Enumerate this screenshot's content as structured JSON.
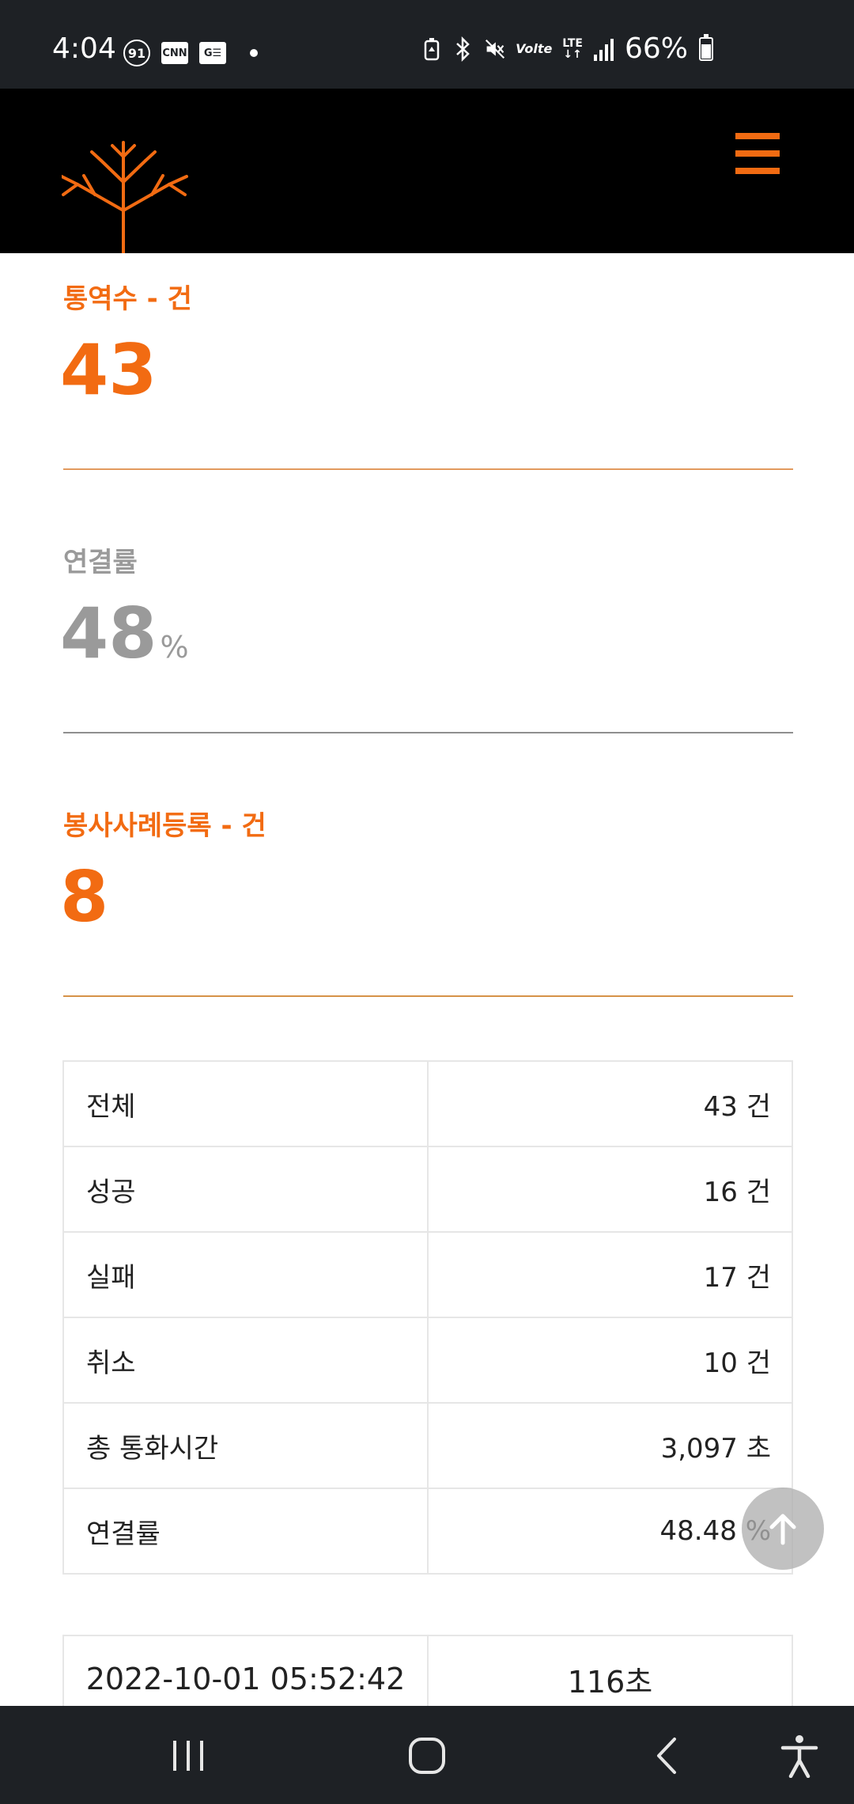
{
  "status_bar": {
    "time": "4:04",
    "aod_badge": "91",
    "cnn_icon": "CNN",
    "ge_icon": "G☰",
    "battery_percent": "66%",
    "volte": "Volte",
    "lte": "LTE",
    "icons": [
      "battery-saver-icon",
      "bluetooth-icon",
      "mute-icon",
      "volte-icon",
      "lte-icon",
      "signal-icon",
      "battery-icon"
    ]
  },
  "header": {
    "logo": "tree-logo-icon",
    "menu": "hamburger-menu-icon"
  },
  "stats": [
    {
      "label": "통역수 - 건",
      "value": "43",
      "unit": ""
    },
    {
      "label": "연결률",
      "value": "48",
      "unit": "%"
    },
    {
      "label": "봉사사례등록 - 건",
      "value": "8",
      "unit": ""
    }
  ],
  "summary": [
    {
      "label": "전체",
      "value": "43 건"
    },
    {
      "label": "성공",
      "value": "16 건"
    },
    {
      "label": "실패",
      "value": "17 건"
    },
    {
      "label": "취소",
      "value": "10 건"
    },
    {
      "label": "총 통화시간",
      "value": "3,097 초"
    },
    {
      "label": "연결률",
      "value": "48.48 %"
    }
  ],
  "records": [
    {
      "datetime": "2022-10-01 05:52:42",
      "duration": "116초"
    }
  ],
  "colors": {
    "accent": "#f26b12",
    "muted": "#9a9a9a",
    "header_bg": "#000000",
    "system_bar_bg": "#1e2125"
  }
}
